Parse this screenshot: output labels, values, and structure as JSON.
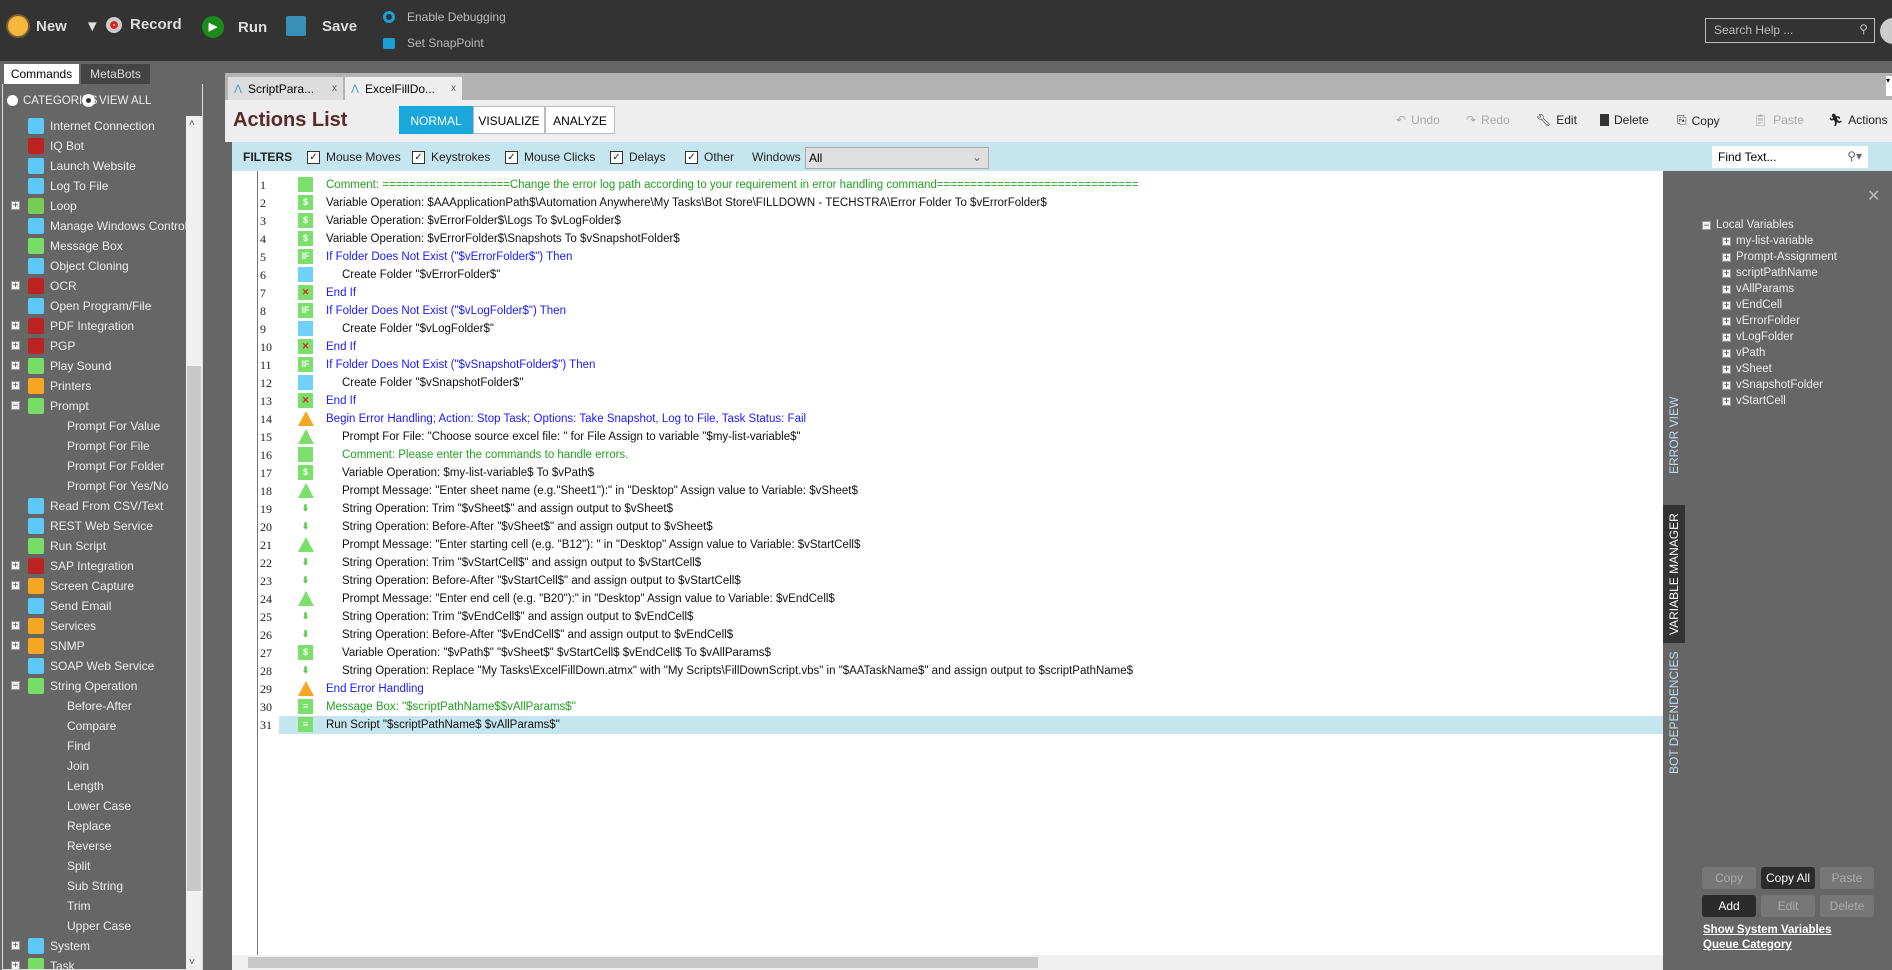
{
  "toolbar": {
    "new": "New",
    "record": "Record",
    "run": "Run",
    "save": "Save",
    "enable_debugging": "Enable Debugging",
    "set_snappoint": "Set SnapPoint",
    "search_placeholder": "Search Help ..."
  },
  "sidebar": {
    "tabs": [
      "Commands",
      "MetaBots"
    ],
    "radio_categories": "CATEGORIES",
    "radio_view_all": "VIEW ALL",
    "items": [
      {
        "label": "Internet Connection",
        "icon": "globe-icon",
        "color": "#5bc8f5",
        "level": 0
      },
      {
        "label": "IQ Bot",
        "icon": "iqbot-icon",
        "color": "#b22",
        "level": 0
      },
      {
        "label": "Launch Website",
        "icon": "browser-icon",
        "color": "#5bc8f5",
        "level": 0
      },
      {
        "label": "Log To File",
        "icon": "edit-icon",
        "color": "#5bc8f5",
        "level": 0
      },
      {
        "label": "Loop",
        "icon": "loop-icon",
        "color": "#7c5",
        "level": 0,
        "exp": "+"
      },
      {
        "label": "Manage Windows Controls",
        "icon": "checklist-icon",
        "color": "#5bc8f5",
        "level": 0
      },
      {
        "label": "Message Box",
        "icon": "message-icon",
        "color": "#7d6",
        "level": 0
      },
      {
        "label": "Object Cloning",
        "icon": "flask-icon",
        "color": "#5bc8f5",
        "level": 0
      },
      {
        "label": "OCR",
        "icon": "ocr-icon",
        "color": "#b22",
        "level": 0,
        "exp": "+"
      },
      {
        "label": "Open Program/File",
        "icon": "folder-icon",
        "color": "#5bc8f5",
        "level": 0
      },
      {
        "label": "PDF Integration",
        "icon": "pdf-icon",
        "color": "#b22",
        "level": 0,
        "exp": "+"
      },
      {
        "label": "PGP",
        "icon": "key-icon",
        "color": "#b22",
        "level": 0,
        "exp": "+"
      },
      {
        "label": "Play Sound",
        "icon": "speaker-icon",
        "color": "#7d6",
        "level": 0,
        "exp": "+"
      },
      {
        "label": "Printers",
        "icon": "printer-icon",
        "color": "#f5a623",
        "level": 0,
        "exp": "+"
      },
      {
        "label": "Prompt",
        "icon": "warning-icon",
        "color": "#7d6",
        "level": 0,
        "exp": "-"
      },
      {
        "label": "Prompt For Value",
        "level": 1
      },
      {
        "label": "Prompt For File",
        "level": 1
      },
      {
        "label": "Prompt For Folder",
        "level": 1
      },
      {
        "label": "Prompt For Yes/No",
        "level": 1
      },
      {
        "label": "Read From CSV/Text",
        "icon": "grid-icon",
        "color": "#5bc8f5",
        "level": 0
      },
      {
        "label": "REST Web Service",
        "icon": "monitor-icon",
        "color": "#5bc8f5",
        "level": 0
      },
      {
        "label": "Run Script",
        "icon": "script-icon",
        "color": "#7d6",
        "level": 0
      },
      {
        "label": "SAP Integration",
        "icon": "sap-icon",
        "color": "#b22",
        "level": 0,
        "exp": "+"
      },
      {
        "label": "Screen Capture",
        "icon": "camera-icon",
        "color": "#f5a623",
        "level": 0,
        "exp": "+"
      },
      {
        "label": "Send Email",
        "icon": "envelope-icon",
        "color": "#5bc8f5",
        "level": 0
      },
      {
        "label": "Services",
        "icon": "hierarchy-icon",
        "color": "#f5a623",
        "level": 0,
        "exp": "+"
      },
      {
        "label": "SNMP",
        "icon": "computer-icon",
        "color": "#f5a623",
        "level": 0,
        "exp": "+"
      },
      {
        "label": "SOAP Web Service",
        "icon": "monitor-icon",
        "color": "#5bc8f5",
        "level": 0
      },
      {
        "label": "String Operation",
        "icon": "string-icon",
        "color": "#7d6",
        "level": 0,
        "exp": "-"
      },
      {
        "label": "Before-After",
        "level": 1
      },
      {
        "label": "Compare",
        "level": 1
      },
      {
        "label": "Find",
        "level": 1
      },
      {
        "label": "Join",
        "level": 1
      },
      {
        "label": "Length",
        "level": 1
      },
      {
        "label": "Lower Case",
        "level": 1
      },
      {
        "label": "Replace",
        "level": 1
      },
      {
        "label": "Reverse",
        "level": 1
      },
      {
        "label": "Split",
        "level": 1
      },
      {
        "label": "Sub String",
        "level": 1
      },
      {
        "label": "Trim",
        "level": 1
      },
      {
        "label": "Upper Case",
        "level": 1
      },
      {
        "label": "System",
        "icon": "computer-icon",
        "color": "#5bc8f5",
        "level": 0,
        "exp": "+"
      },
      {
        "label": "Task",
        "icon": "play-icon",
        "color": "#7d6",
        "level": 0,
        "exp": "+"
      }
    ]
  },
  "file_tabs": [
    {
      "label": "ScriptPara...",
      "active": false
    },
    {
      "label": "ExcelFillDo...",
      "active": true
    }
  ],
  "actions": {
    "title": "Actions List",
    "modes": [
      "NORMAL",
      "VISUALIZE",
      "ANALYZE"
    ],
    "undo": "Undo",
    "redo": "Redo",
    "edit": "Edit",
    "delete": "Delete",
    "copy": "Copy",
    "paste": "Paste",
    "actions": "Actions"
  },
  "filters": {
    "label": "FILTERS",
    "checks": [
      "Mouse Moves",
      "Keystrokes",
      "Mouse Clicks",
      "Delays",
      "Other"
    ],
    "windows_label": "Windows",
    "windows_value": "All",
    "find_placeholder": "Find Text..."
  },
  "colors": {
    "green": "#228b22",
    "blue": "#1a1aff",
    "black": "#111",
    "comment": "#21a121",
    "highlight": "#c5e6ee"
  },
  "lines": [
    {
      "n": "1",
      "icon": "comment",
      "ind": 0,
      "c": "green",
      "t": "Comment: ===================Change the error log path according to your requirement in error handling command=============================="
    },
    {
      "n": "2",
      "icon": "var",
      "ind": 0,
      "c": "black",
      "t": "Variable Operation: $AAApplicationPath$\\Automation Anywhere\\My Tasks\\Bot Store\\FILLDOWN - TECHSTRA\\Error Folder To $vErrorFolder$"
    },
    {
      "n": "3",
      "icon": "var",
      "ind": 0,
      "c": "black",
      "t": "Variable Operation: $vErrorFolder$\\Logs To $vLogFolder$"
    },
    {
      "n": "4",
      "icon": "var",
      "ind": 0,
      "c": "black",
      "t": "Variable Operation: $vErrorFolder$\\Snapshots To $vSnapshotFolder$"
    },
    {
      "n": "5",
      "icon": "if",
      "ind": 0,
      "c": "blue",
      "t": "If Folder Does Not Exist (\"$vErrorFolder$\")  Then"
    },
    {
      "n": "6",
      "icon": "folder",
      "ind": 1,
      "c": "black",
      "t": "Create Folder \"$vErrorFolder$\""
    },
    {
      "n": "7",
      "icon": "endif",
      "ind": 0,
      "c": "blue",
      "t": "End If"
    },
    {
      "n": "8",
      "icon": "if",
      "ind": 0,
      "c": "blue",
      "t": "If Folder Does Not Exist (\"$vLogFolder$\")  Then"
    },
    {
      "n": "9",
      "icon": "folder",
      "ind": 1,
      "c": "black",
      "t": "Create Folder \"$vLogFolder$\""
    },
    {
      "n": "10",
      "icon": "endif",
      "ind": 0,
      "c": "blue",
      "t": "End If"
    },
    {
      "n": "11",
      "icon": "if",
      "ind": 0,
      "c": "blue",
      "t": "If Folder Does Not Exist (\"$vSnapshotFolder$\")  Then"
    },
    {
      "n": "12",
      "icon": "folder",
      "ind": 1,
      "c": "black",
      "t": "Create Folder \"$vSnapshotFolder$\""
    },
    {
      "n": "13",
      "icon": "endif",
      "ind": 0,
      "c": "blue",
      "t": "End If"
    },
    {
      "n": "14",
      "icon": "error",
      "ind": 0,
      "c": "blue",
      "t": "Begin Error Handling; Action: Stop Task; Options: Take Snapshot, Log to File,  Task Status: Fail"
    },
    {
      "n": "15",
      "icon": "prompt",
      "ind": 1,
      "c": "black",
      "t": "Prompt For File: \"Choose source excel file: \" for File Assign to variable \"$my-list-variable$\""
    },
    {
      "n": "16",
      "icon": "comment",
      "ind": 1,
      "c": "green",
      "t": "Comment: Please enter the commands to handle errors."
    },
    {
      "n": "17",
      "icon": "var",
      "ind": 1,
      "c": "black",
      "t": "Variable Operation: $my-list-variable$ To $vPath$"
    },
    {
      "n": "18",
      "icon": "prompt",
      "ind": 1,
      "c": "black",
      "t": "Prompt Message: \"Enter sheet name (e.g.\"Sheet1\"):\" in \"Desktop\" Assign value to Variable: $vSheet$"
    },
    {
      "n": "19",
      "icon": "string",
      "ind": 1,
      "c": "black",
      "t": "String Operation: Trim \"$vSheet$\" and assign output to $vSheet$"
    },
    {
      "n": "20",
      "icon": "string",
      "ind": 1,
      "c": "black",
      "t": "String Operation: Before-After \"$vSheet$\" and assign output to $vSheet$"
    },
    {
      "n": "21",
      "icon": "prompt",
      "ind": 1,
      "c": "black",
      "t": "Prompt Message: \"Enter starting cell (e.g. \"B12\"): \" in \"Desktop\" Assign value to Variable: $vStartCell$"
    },
    {
      "n": "22",
      "icon": "string",
      "ind": 1,
      "c": "black",
      "t": "String Operation: Trim \"$vStartCell$\" and assign output to $vStartCell$"
    },
    {
      "n": "23",
      "icon": "string",
      "ind": 1,
      "c": "black",
      "t": "String Operation: Before-After \"$vStartCell$\" and assign output to $vStartCell$"
    },
    {
      "n": "24",
      "icon": "prompt",
      "ind": 1,
      "c": "black",
      "t": "Prompt Message: \"Enter end cell (e.g. \"B20\"):\" in \"Desktop\" Assign value to Variable: $vEndCell$"
    },
    {
      "n": "25",
      "icon": "string",
      "ind": 1,
      "c": "black",
      "t": "String Operation: Trim \"$vEndCell$\" and assign output to $vEndCell$"
    },
    {
      "n": "26",
      "icon": "string",
      "ind": 1,
      "c": "black",
      "t": "String Operation: Before-After \"$vEndCell$\" and assign output to $vEndCell$"
    },
    {
      "n": "27",
      "icon": "var",
      "ind": 1,
      "c": "black",
      "t": "Variable Operation: \"$vPath$\" \"$vSheet$\" $vStartCell$ $vEndCell$ To $vAllParams$"
    },
    {
      "n": "28",
      "icon": "string",
      "ind": 1,
      "c": "black",
      "t": "String Operation: Replace \"My Tasks\\ExcelFillDown.atmx\" with \"My Scripts\\FillDownScript.vbs\" in \"$AATaskName$\" and assign output to $scriptPathName$"
    },
    {
      "n": "29",
      "icon": "error",
      "ind": 0,
      "c": "blue",
      "t": "End Error Handling"
    },
    {
      "n": "30",
      "icon": "msgbox",
      "ind": 0,
      "c": "green",
      "t": "Message Box: \"$scriptPathName$$vAllParams$\""
    },
    {
      "n": "31",
      "icon": "script",
      "ind": 0,
      "c": "black",
      "t": "Run Script \"$scriptPathName$ $vAllParams$\"",
      "selected": true
    }
  ],
  "right_panel": {
    "vtabs": [
      "ERROR VIEW",
      "VARIABLE MANAGER",
      "BOT DEPENDENCIES"
    ],
    "active_vtab": "VARIABLE MANAGER",
    "root": "Local Variables",
    "variables": [
      "my-list-variable",
      "Prompt-Assignment",
      "scriptPathName",
      "vAllParams",
      "vEndCell",
      "vErrorFolder",
      "vLogFolder",
      "vPath",
      "vSheet",
      "vSnapshotFolder",
      "vStartCell"
    ],
    "buttons_row1": [
      "Copy",
      "Copy All",
      "Paste"
    ],
    "buttons_row2": [
      "Add",
      "Edit",
      "Delete"
    ],
    "link_system": "Show System Variables",
    "link_queue": "Queue Category"
  }
}
